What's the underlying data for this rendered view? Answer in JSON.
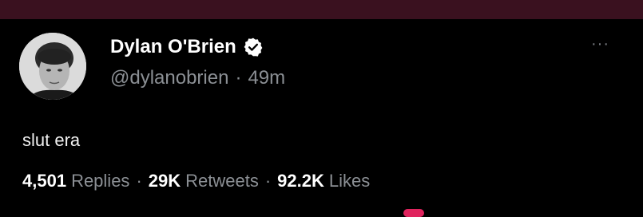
{
  "tweet": {
    "author": {
      "display_name": "Dylan O'Brien",
      "handle": "@dylanobrien",
      "verified": true,
      "avatar_icon": "profile-photo"
    },
    "separator": "·",
    "time_ago": "49m",
    "more_icon": "more-horizontal-icon",
    "text": "slut era",
    "stats": {
      "replies_count": "4,501",
      "replies_label": "Replies",
      "retweets_count": "29K",
      "retweets_label": "Retweets",
      "likes_count": "92.2K",
      "likes_label": "Likes"
    }
  },
  "colors": {
    "background": "#000000",
    "top_strip": "#3a111f",
    "primary_text": "#ffffff",
    "secondary_text": "#8b8f94",
    "verified_badge": "#ffffff"
  }
}
